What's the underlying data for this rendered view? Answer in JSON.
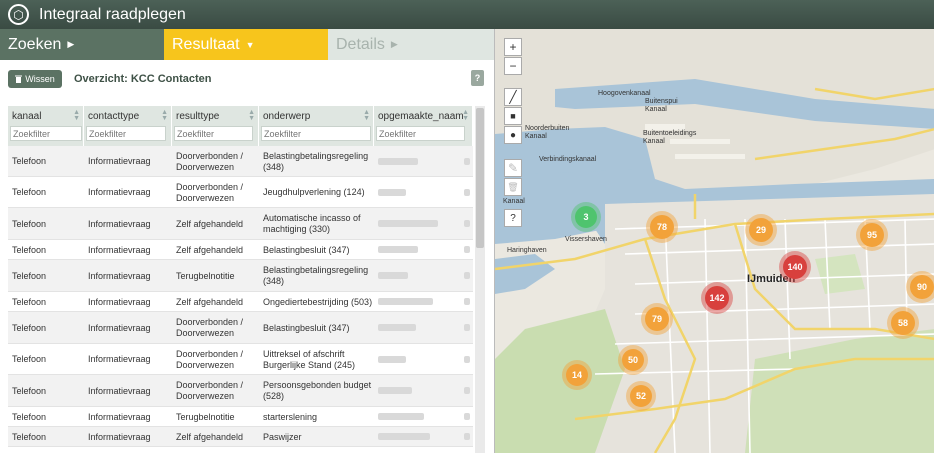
{
  "app": {
    "title": "Integraal raadplegen"
  },
  "steps": [
    {
      "label": "Zoeken",
      "arrow": "▶"
    },
    {
      "label": "Resultaat",
      "arrow": "▼"
    },
    {
      "label": "Details",
      "arrow": "▶"
    }
  ],
  "toolbar": {
    "clear_label": "Wissen",
    "clear_icon": "trash-icon",
    "overview": "Overzicht: KCC Contacten",
    "help": "?"
  },
  "table": {
    "columns": [
      {
        "label": "kanaal",
        "placeholder": "Zoekfilter"
      },
      {
        "label": "contacttype",
        "placeholder": "Zoekfilter"
      },
      {
        "label": "resulttype",
        "placeholder": "Zoekfilter"
      },
      {
        "label": "onderwerp",
        "placeholder": "Zoekfilter"
      },
      {
        "label": "opgemaakte_naam",
        "placeholder": "Zoekfilter"
      }
    ],
    "rows": [
      [
        "Telefoon",
        "Informatievraag",
        [
          "Doorverbonden /",
          "Doorverwezen"
        ],
        [
          "Belastingbetalingsregeling",
          "(348)"
        ]
      ],
      [
        "Telefoon",
        "Informatievraag",
        [
          "Doorverbonden /",
          "Doorverwezen"
        ],
        [
          "Jeugdhulpverlening (124)"
        ]
      ],
      [
        "Telefoon",
        "Informatievraag",
        [
          "Zelf afgehandeld"
        ],
        [
          "Automatische incasso of",
          "machtiging (330)"
        ]
      ],
      [
        "Telefoon",
        "Informatievraag",
        [
          "Zelf afgehandeld"
        ],
        [
          "Belastingbesluit (347)"
        ]
      ],
      [
        "Telefoon",
        "Informatievraag",
        [
          "Terugbelnotitie"
        ],
        [
          "Belastingbetalingsregeling",
          "(348)"
        ]
      ],
      [
        "Telefoon",
        "Informatievraag",
        [
          "Zelf afgehandeld"
        ],
        [
          "Ongediertebestrijding (503)"
        ]
      ],
      [
        "Telefoon",
        "Informatievraag",
        [
          "Doorverbonden /",
          "Doorverwezen"
        ],
        [
          "Belastingbesluit (347)"
        ]
      ],
      [
        "Telefoon",
        "Informatievraag",
        [
          "Doorverbonden /",
          "Doorverwezen"
        ],
        [
          "Uittreksel of afschrift",
          "Burgerlijke Stand (245)"
        ]
      ],
      [
        "Telefoon",
        "Informatievraag",
        [
          "Doorverbonden /",
          "Doorverwezen"
        ],
        [
          "Persoonsgebonden budget",
          "(528)"
        ]
      ],
      [
        "Telefoon",
        "Informatievraag",
        [
          "Terugbelnotitie"
        ],
        [
          "starterslening"
        ]
      ],
      [
        "Telefoon",
        "Informatievraag",
        [
          "Zelf afgehandeld"
        ],
        [
          "Paswijzer"
        ]
      ]
    ]
  },
  "map": {
    "controls": [
      "+",
      "−",
      "╱",
      "■",
      "●",
      "✎",
      "🗑",
      "?"
    ],
    "labels": {
      "hoogovenkanaal": "Hoogovenkanaal",
      "buitenspui": "Buitenspui\nKanaal",
      "buitentoeleidings": "Buitentoeleidings\nKanaal",
      "noordbuiten": "Noorderbuiten\nKanaal",
      "verbindingskanaal": "Verbindingskanaal",
      "vissershaven": "Vissershaven",
      "haringhaven": "Haringhaven",
      "ijmuiden": "IJmuiden",
      "kanaal": "Kanaal"
    },
    "clusters": [
      {
        "count": "3",
        "color": "green"
      },
      {
        "count": "78",
        "color": "orange"
      },
      {
        "count": "29",
        "color": "orange"
      },
      {
        "count": "95",
        "color": "orange"
      },
      {
        "count": "140",
        "color": "red"
      },
      {
        "count": "142",
        "color": "red"
      },
      {
        "count": "90",
        "color": "orange"
      },
      {
        "count": "79",
        "color": "orange"
      },
      {
        "count": "58",
        "color": "orange"
      },
      {
        "count": "50",
        "color": "orange"
      },
      {
        "count": "14",
        "color": "orange"
      },
      {
        "count": "52",
        "color": "orange"
      }
    ]
  }
}
